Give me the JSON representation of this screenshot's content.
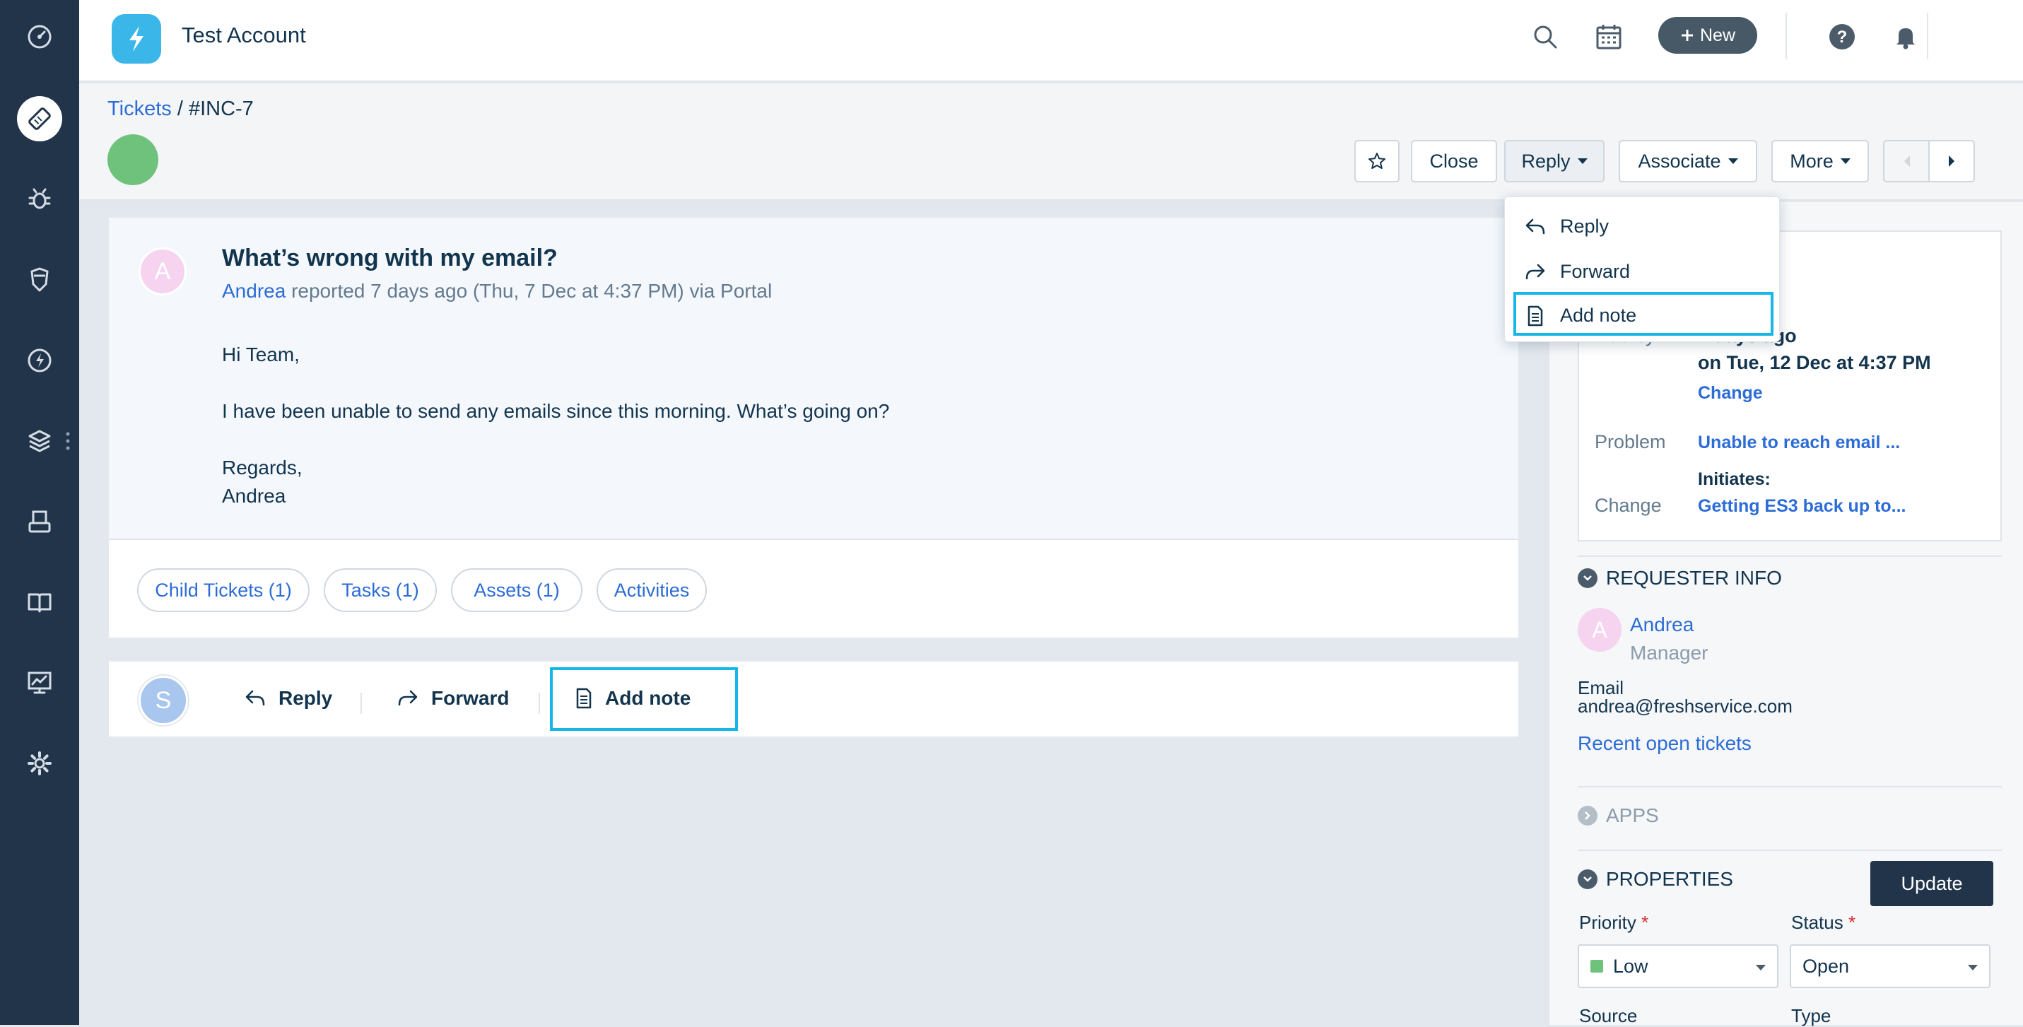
{
  "header": {
    "account_name": "Test Account",
    "new_label": "New",
    "user_initial": "S"
  },
  "sidebar": {
    "items": [
      {
        "name": "dashboard",
        "icon": "speedometer-icon"
      },
      {
        "name": "tickets",
        "icon": "ticket-icon",
        "active": true
      },
      {
        "name": "problems",
        "icon": "bug-icon"
      },
      {
        "name": "changes",
        "icon": "shield-icon"
      },
      {
        "name": "releases",
        "icon": "lightning-icon"
      },
      {
        "name": "assets",
        "icon": "layers-icon"
      },
      {
        "name": "solutions",
        "icon": "printer-icon"
      },
      {
        "name": "knowledge",
        "icon": "book-icon"
      },
      {
        "name": "reports",
        "icon": "chart-icon"
      },
      {
        "name": "admin",
        "icon": "gear-icon"
      }
    ]
  },
  "breadcrumb": {
    "parent": "Tickets",
    "separator": " / ",
    "current": "#INC-7"
  },
  "toolbar": {
    "close_label": "Close",
    "reply_label": "Reply",
    "associate_label": "Associate",
    "more_label": "More"
  },
  "dropdown": {
    "reply_label": "Reply",
    "forward_label": "Forward",
    "add_note_label": "Add note"
  },
  "ticket": {
    "requester_initial": "A",
    "subject": "What’s wrong with my email?",
    "requester_name": "Andrea",
    "meta_text": " reported 7 days ago (Thu, 7 Dec at 4:37 PM) via Portal",
    "body": {
      "greeting": "Hi Team,",
      "line1": "I have been unable to send any emails since this morning. What’s going on?",
      "closing": "Regards,",
      "signature": "Andrea"
    },
    "tabs": {
      "child_tickets": "Child Tickets (1)",
      "tasks": "Tasks  (1)",
      "assets": "Assets (1)",
      "activities": "Activities"
    }
  },
  "reply_bar": {
    "agent_initial": "S",
    "reply_label": "Reply",
    "forward_label": "Forward",
    "add_note_label": "Add note"
  },
  "details": {
    "due_label": "Due by",
    "due_value": "2 days ago",
    "due_date": "on Tue, 12 Dec at 4:37 PM",
    "change_link": "Change",
    "problem_label": "Problem",
    "problem_link": "Unable to reach email ...",
    "initiates_label": "Initiates:",
    "change_label": "Change",
    "change_value_link": "Getting ES3 back up to..."
  },
  "requester_info": {
    "heading": "REQUESTER INFO",
    "initial": "A",
    "name": "Andrea",
    "title": "Manager",
    "email_label": "Email",
    "email": "andrea@freshservice.com",
    "recent_link": "Recent open tickets"
  },
  "apps": {
    "heading": "APPS"
  },
  "properties": {
    "heading": "PROPERTIES",
    "update_label": "Update",
    "priority_label": "Priority",
    "priority_value": "Low",
    "status_label": "Status",
    "status_value": "Open",
    "source_label": "Source",
    "type_label": "Type",
    "required_mark": "*"
  },
  "colors": {
    "sidebar_bg": "#21344a",
    "link": "#2c6cd6",
    "highlight": "#17b6e8",
    "priority_low": "#6ec27c",
    "ticket_status_dot": "#6ec27c"
  }
}
